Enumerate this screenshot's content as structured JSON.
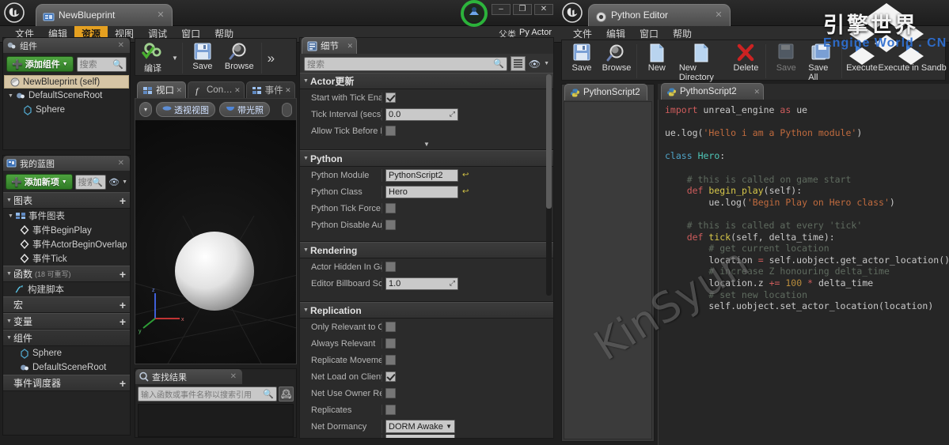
{
  "blueprint_window": {
    "tab_title": "NewBlueprint",
    "window_controls": {
      "minimize": "–",
      "maximize": "❐",
      "close": "✕"
    },
    "parent_class_label": "父类",
    "parent_class_value": "Py Actor",
    "menu": [
      "文件",
      "编辑",
      "资源",
      "视图",
      "调试",
      "窗口",
      "帮助"
    ],
    "menu_active_index": 2,
    "toolbar": [
      {
        "label": "编译",
        "icon": "compile-icon"
      },
      {
        "label": "Save",
        "icon": "save-icon"
      },
      {
        "label": "Browse",
        "icon": "browse-icon"
      }
    ],
    "toolbar_overflow": "»",
    "components_panel": {
      "title": "组件",
      "add_button": "添加组件",
      "search_placeholder": "搜索",
      "tree": [
        {
          "label": "NewBlueprint (self)",
          "icon": "blueprint-self-icon",
          "selected": true,
          "indent": 0
        },
        {
          "label": "DefaultSceneRoot",
          "icon": "scene-root-icon",
          "selected": false,
          "indent": 0,
          "expander": true
        },
        {
          "label": "Sphere",
          "icon": "sphere-component-icon",
          "selected": false,
          "indent": 1
        }
      ]
    },
    "my_blueprint_panel": {
      "title": "我的蓝图",
      "add_button": "添加新项",
      "search_placeholder": "搜索",
      "sections": [
        {
          "name": "图表",
          "suffix": "",
          "has_plus": true,
          "items": [
            {
              "label": "事件图表",
              "icon": "event-graph-icon",
              "indent": 0,
              "expander": true
            },
            {
              "label": "事件BeginPlay",
              "icon": "event-node-icon",
              "indent": 1
            },
            {
              "label": "事件ActorBeginOverlap",
              "icon": "event-node-icon",
              "indent": 1
            },
            {
              "label": "事件Tick",
              "icon": "event-node-icon",
              "indent": 1
            }
          ]
        },
        {
          "name": "函数",
          "suffix": "(18 可重写)",
          "has_plus": true,
          "items": [
            {
              "label": "构建脚本",
              "icon": "function-icon",
              "indent": 1
            }
          ]
        },
        {
          "name": "宏",
          "suffix": "",
          "has_plus": true,
          "items": []
        },
        {
          "name": "变量",
          "suffix": "",
          "has_plus": true,
          "items": []
        },
        {
          "name": "组件",
          "suffix": "",
          "has_plus": false,
          "items": [
            {
              "label": "Sphere",
              "icon": "sphere-component-icon",
              "indent": 1
            },
            {
              "label": "DefaultSceneRoot",
              "icon": "scene-root-icon",
              "indent": 1
            }
          ]
        },
        {
          "name": "事件调度器",
          "suffix": "",
          "has_plus": true,
          "items": []
        }
      ]
    },
    "viewport_panel": {
      "tabs": [
        {
          "label": "视口",
          "icon": "viewport-icon",
          "active": true
        },
        {
          "label": "Con…",
          "icon": "construction-script-icon",
          "active": false
        },
        {
          "label": "事件",
          "icon": "event-graph-icon",
          "active": false
        }
      ],
      "view_buttons": [
        {
          "label": "透视视图",
          "icon": "perspective-icon"
        },
        {
          "label": "带光照",
          "icon": "lit-icon"
        }
      ],
      "menu_caret": "▾",
      "axis": {
        "x": "x",
        "y": "y",
        "z": "z"
      }
    },
    "find_results_panel": {
      "title": "查找结果",
      "search_placeholder": "输入函数或事件名称以搜索引用"
    },
    "details_panel": {
      "title": "细节",
      "search_placeholder": "搜索",
      "categories": [
        {
          "name": "Actor更新",
          "rows": [
            {
              "label": "Start with Tick Enabl",
              "type": "checkbox",
              "value": true
            },
            {
              "label": "Tick Interval (secs)",
              "type": "number",
              "value": "0.0"
            },
            {
              "label": "Allow Tick Before Be",
              "type": "checkbox",
              "value": false
            }
          ],
          "expander": "▼"
        },
        {
          "name": "Python",
          "rows": [
            {
              "label": "Python Module",
              "type": "text",
              "value": "PythonScript2",
              "revert": true
            },
            {
              "label": "Python Class",
              "type": "text",
              "value": "Hero",
              "revert": true
            },
            {
              "label": "Python Tick Force Di",
              "type": "checkbox",
              "value": false
            },
            {
              "label": "Python Disable Auto ",
              "type": "checkbox",
              "value": false
            }
          ]
        },
        {
          "name": "Rendering",
          "rows": [
            {
              "label": "Actor Hidden In Gam",
              "type": "checkbox",
              "value": false
            },
            {
              "label": "Editor Billboard Scale",
              "type": "number",
              "value": "1.0"
            }
          ]
        },
        {
          "name": "Replication",
          "rows": [
            {
              "label": "Only Relevant to Own",
              "type": "checkbox",
              "value": false
            },
            {
              "label": "Always Relevant",
              "type": "checkbox",
              "value": false
            },
            {
              "label": "Replicate Movement",
              "type": "checkbox",
              "value": false
            },
            {
              "label": "Net Load on Client",
              "type": "checkbox",
              "value": true
            },
            {
              "label": "Net Use Owner Relev",
              "type": "checkbox",
              "value": false
            },
            {
              "label": "Replicates",
              "type": "checkbox",
              "value": false
            },
            {
              "label": "Net Dormancy",
              "type": "dropdown",
              "value": "DORM Awake"
            }
          ]
        }
      ]
    }
  },
  "python_window": {
    "tab_title": "Python Editor",
    "menu": [
      "文件",
      "编辑",
      "窗口",
      "帮助"
    ],
    "toolbar": [
      {
        "label": "Save",
        "icon": "save-icon",
        "disabled": false
      },
      {
        "label": "Browse",
        "icon": "browse-icon",
        "disabled": false
      },
      {
        "label": "New",
        "icon": "new-file-icon",
        "disabled": false
      },
      {
        "label": "New Directory",
        "icon": "new-directory-icon",
        "disabled": false
      },
      {
        "label": "Delete",
        "icon": "delete-icon",
        "disabled": false
      },
      {
        "label": "Save",
        "icon": "save-icon",
        "disabled": true
      },
      {
        "label": "Save All",
        "icon": "save-all-icon",
        "disabled": false
      },
      {
        "label": "Execute",
        "icon": "execute-icon",
        "disabled": false
      },
      {
        "label": "Execute in Sandb",
        "icon": "execute-sandbox-icon",
        "disabled": false
      }
    ],
    "file_tree": [
      {
        "label": "PythonScript2",
        "icon": "python-file-icon",
        "selected": true
      }
    ],
    "open_tab": {
      "label": "PythonScript2",
      "icon": "python-file-icon"
    },
    "code_lines": [
      [
        {
          "t": "import",
          "c": "k-imp"
        },
        {
          "t": " unreal_engine ",
          "c": "k-pl"
        },
        {
          "t": "as",
          "c": "k-op"
        },
        {
          "t": " ue",
          "c": "k-pl"
        }
      ],
      [],
      [
        {
          "t": "ue.log(",
          "c": "k-pl"
        },
        {
          "t": "'Hello i am a Python module'",
          "c": "k-str"
        },
        {
          "t": ")",
          "c": "k-pl"
        }
      ],
      [],
      [
        {
          "t": "class",
          "c": "k-kw"
        },
        {
          "t": " ",
          "c": "k-pl"
        },
        {
          "t": "Hero",
          "c": "k-cls"
        },
        {
          "t": ":",
          "c": "k-pl"
        }
      ],
      [],
      [
        {
          "t": "    # this is called on game start",
          "c": "k-cmt"
        }
      ],
      [
        {
          "t": "    ",
          "c": "k-pl"
        },
        {
          "t": "def",
          "c": "k-def"
        },
        {
          "t": " ",
          "c": "k-pl"
        },
        {
          "t": "begin_play",
          "c": "k-fn"
        },
        {
          "t": "(self):",
          "c": "k-pl"
        }
      ],
      [
        {
          "t": "        ue.log(",
          "c": "k-pl"
        },
        {
          "t": "'Begin Play on Hero class'",
          "c": "k-str"
        },
        {
          "t": ")",
          "c": "k-pl"
        }
      ],
      [],
      [
        {
          "t": "    # this is called at every 'tick'",
          "c": "k-cmt"
        }
      ],
      [
        {
          "t": "    ",
          "c": "k-pl"
        },
        {
          "t": "def",
          "c": "k-def"
        },
        {
          "t": " ",
          "c": "k-pl"
        },
        {
          "t": "tick",
          "c": "k-fn"
        },
        {
          "t": "(self, delta_time):",
          "c": "k-pl"
        }
      ],
      [
        {
          "t": "        # get current location",
          "c": "k-cmt"
        }
      ],
      [
        {
          "t": "        location ",
          "c": "k-pl"
        },
        {
          "t": "=",
          "c": "k-op"
        },
        {
          "t": " self.uobject.get_actor_location()",
          "c": "k-pl"
        }
      ],
      [
        {
          "t": "        # increase Z honouring delta_time",
          "c": "k-cmt"
        }
      ],
      [
        {
          "t": "        location.z ",
          "c": "k-pl"
        },
        {
          "t": "+=",
          "c": "k-op"
        },
        {
          "t": " ",
          "c": "k-pl"
        },
        {
          "t": "100",
          "c": "k-num"
        },
        {
          "t": " ",
          "c": "k-pl"
        },
        {
          "t": "*",
          "c": "k-op"
        },
        {
          "t": " delta_time",
          "c": "k-pl"
        }
      ],
      [
        {
          "t": "        # set new location",
          "c": "k-cmt"
        }
      ],
      [
        {
          "t": "        self.uobject.set_actor_location(location)",
          "c": "k-pl"
        }
      ]
    ]
  },
  "watermarks": {
    "diagonal": "KinSyun",
    "brand_cn": "引擎世界",
    "brand_en": "Engine World . CN"
  },
  "colors": {
    "accent_orange": "#e5a020",
    "green_button": "#4ea33f",
    "selection_tan": "#d6c5a5",
    "panel_bg": "#242424",
    "watermark_blue": "#2f6fd0"
  }
}
